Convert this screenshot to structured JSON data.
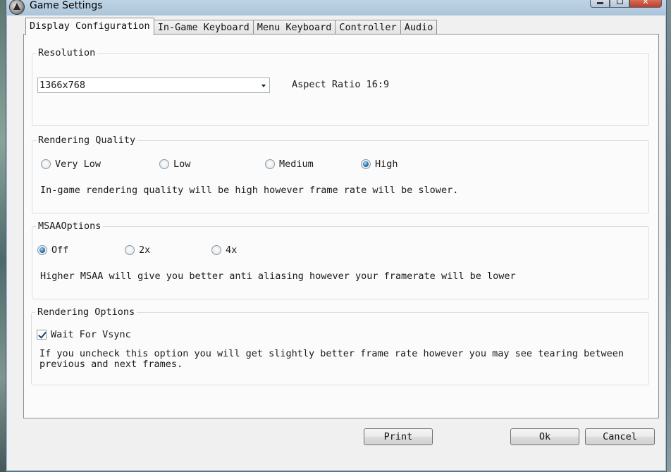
{
  "window": {
    "title": "Game Settings"
  },
  "tabs": [
    {
      "label": "Display Configuration",
      "active": true
    },
    {
      "label": "In-Game Keyboard",
      "active": false
    },
    {
      "label": "Menu Keyboard",
      "active": false
    },
    {
      "label": "Controller",
      "active": false
    },
    {
      "label": "Audio",
      "active": false
    }
  ],
  "resolution": {
    "title": "Resolution",
    "selected": "1366x768",
    "aspect_ratio": "Aspect Ratio 16:9"
  },
  "rendering_quality": {
    "title": "Rendering Quality",
    "options": [
      "Very Low",
      "Low",
      "Medium",
      "High"
    ],
    "selected": "High",
    "description": "In-game rendering quality will be high however frame rate will be slower."
  },
  "msaa": {
    "title": "MSAAOptions",
    "options": [
      "Off",
      "2x",
      "4x"
    ],
    "selected": "Off",
    "description": "Higher MSAA will give you better anti aliasing however your framerate will be lower"
  },
  "rendering_options": {
    "title": "Rendering Options",
    "vsync_label": "Wait For Vsync",
    "vsync_checked": true,
    "description_line1": "If you uncheck this option you will get slightly better frame rate however you may see tearing between",
    "description_line2": "previous and next frames."
  },
  "buttons": {
    "print": "Print",
    "ok": "Ok",
    "cancel": "Cancel"
  },
  "colors": {
    "accent_radio": "#2f7fbf",
    "titlebar": "#b3cade",
    "close_button": "#d0614a"
  }
}
